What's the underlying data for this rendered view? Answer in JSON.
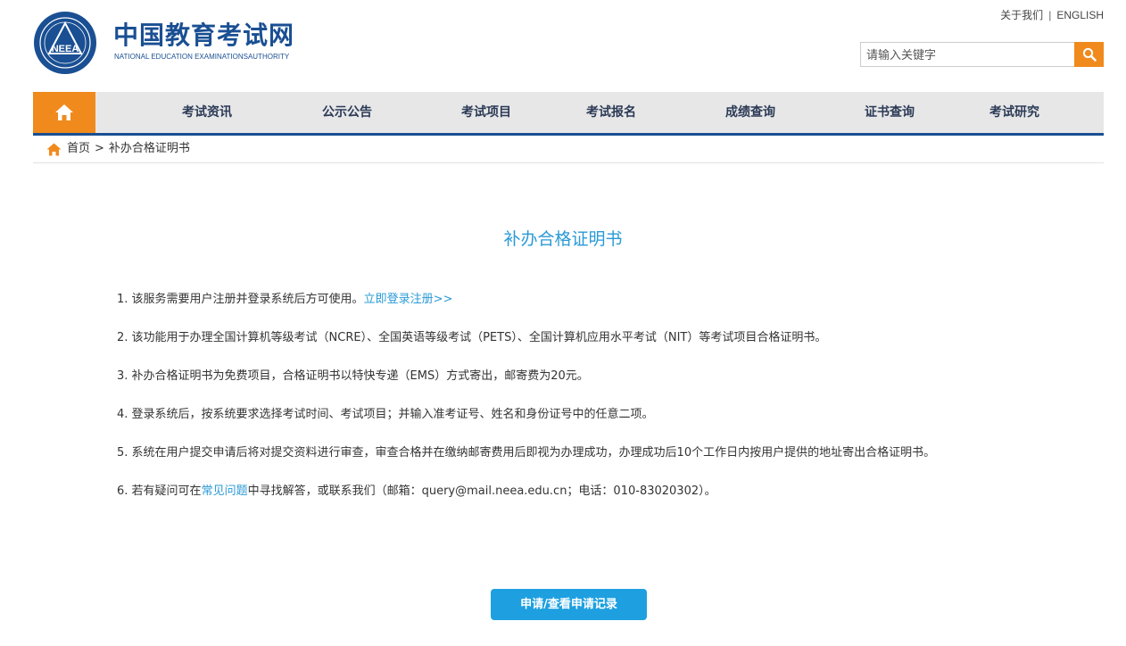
{
  "header": {
    "logo_text": "NEEA",
    "brand_cn": "中国教育考试网",
    "brand_en": "NATIONAL EDUCATION EXAMINATIONSAUTHORITY",
    "top_links": {
      "about": "关于我们",
      "separator": "|",
      "english": "ENGLISH"
    },
    "search": {
      "placeholder": "请输入关键字",
      "icon": "search-icon"
    }
  },
  "nav": {
    "home_icon": "home-icon",
    "items": [
      {
        "label": "考试资讯"
      },
      {
        "label": "公示公告"
      },
      {
        "label": "考试项目"
      },
      {
        "label": "考试报名"
      },
      {
        "label": "成绩查询"
      },
      {
        "label": "证书查询"
      },
      {
        "label": "考试研究"
      }
    ]
  },
  "breadcrumb": {
    "home": "首页",
    "separator": ">",
    "current": "补办合格证明书"
  },
  "main": {
    "title": "补办合格证明书",
    "items": [
      {
        "number": "1.",
        "text": "该服务需要用户注册并登录系统后方可使用。",
        "link": "立即登录注册>>"
      },
      {
        "number": "2.",
        "text": "该功能用于办理全国计算机等级考试（NCRE）、全国英语等级考试（PETS）、全国计算机应用水平考试（NIT）等考试项目合格证明书。"
      },
      {
        "number": "3.",
        "text": "补办合格证明书为免费项目，合格证明书以特快专递（EMS）方式寄出，邮寄费为20元。"
      },
      {
        "number": "4.",
        "text": "登录系统后，按系统要求选择考试时间、考试项目；并输入准考证号、姓名和身份证号中的任意二项。"
      },
      {
        "number": "5.",
        "text": "系统在用户提交申请后将对提交资料进行审查，审查合格并在缴纳邮寄费用后即视为办理成功，办理成功后10个工作日内按用户提供的地址寄出合格证明书。"
      },
      {
        "number": "6.",
        "text_before": "若有疑问可在",
        "link": "常见问题",
        "text_after": "中寻找解答，或联系我们（邮箱：query@mail.neea.edu.cn；电话：010-83020302）。"
      }
    ],
    "apply_button": "申请/查看申请记录"
  },
  "colors": {
    "brand_blue": "#1a4f93",
    "accent_orange": "#f08a1c",
    "link_blue": "#2a9ad6",
    "button_blue": "#1ea0e0",
    "nav_bg": "#e7e7e8"
  }
}
